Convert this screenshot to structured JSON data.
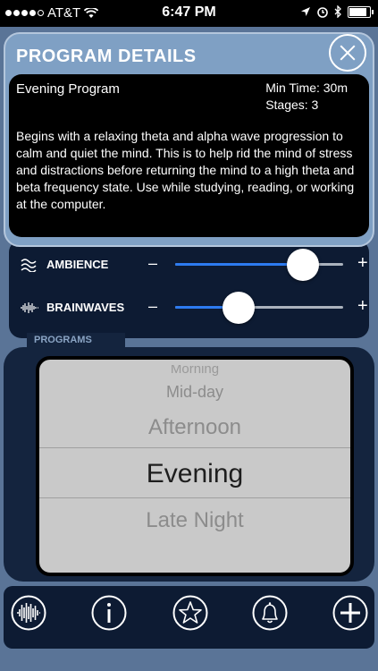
{
  "status_bar": {
    "carrier": "AT&T",
    "time": "6:47 PM"
  },
  "details": {
    "title": "PROGRAM DETAILS",
    "program_name": "Evening Program",
    "min_time": "Min Time: 30m",
    "stages": "Stages: 3",
    "description": "Begins with a relaxing theta and alpha wave progression to calm and quiet the mind.  This is to help rid the mind of stress and distractions before returning the mind to a high theta and beta frequency state.  Use while studying, reading, or working at the computer."
  },
  "sliders": {
    "ambience": {
      "label": "AMBIENCE",
      "minus": "–",
      "plus": "+",
      "level": 0.76
    },
    "brainwaves": {
      "label": "BRAINWAVES",
      "minus": "–",
      "plus": "+",
      "level": 0.38
    }
  },
  "programs": {
    "tab_label": "PROGRAMS",
    "items": [
      "Morning",
      "Mid-day",
      "Afternoon",
      "Evening",
      "Late Night"
    ],
    "selected": "Evening"
  },
  "toolbar": {
    "icons": [
      "waveform-icon",
      "info-icon",
      "star-icon",
      "bell-icon",
      "plus-icon"
    ]
  },
  "colors": {
    "accent": "#2d7bf0",
    "panel": "#7fa0c4",
    "background": "#5a7497"
  }
}
